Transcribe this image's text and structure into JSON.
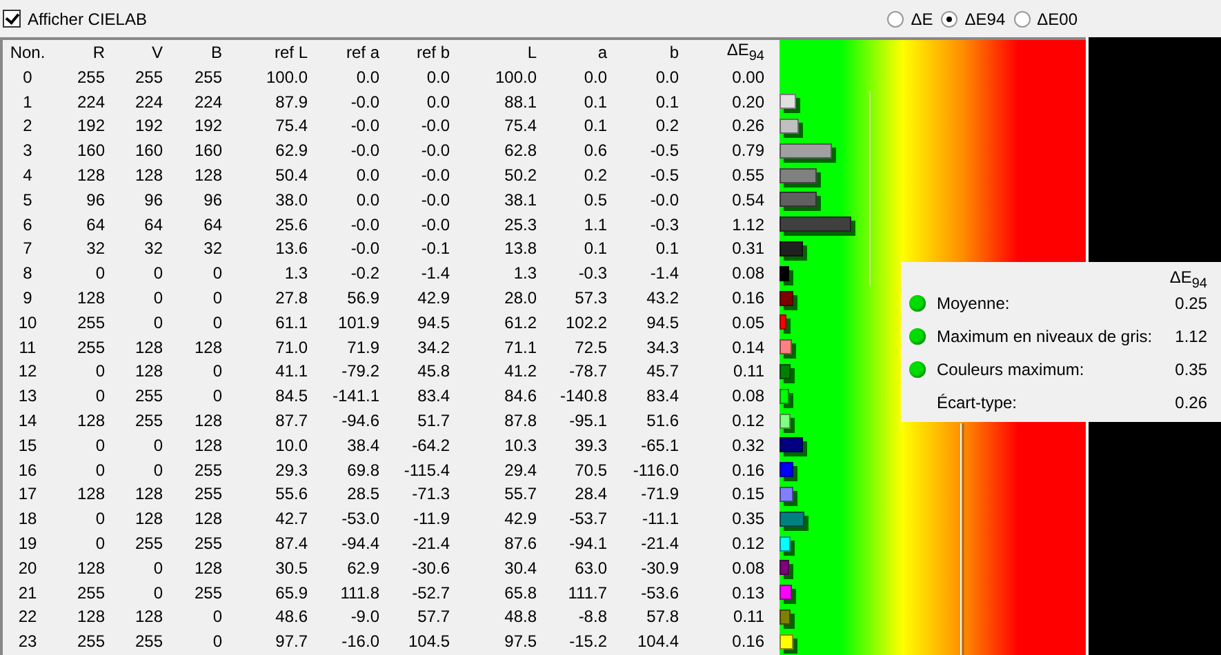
{
  "options": {
    "show_cielab": {
      "label": "Afficher CIELAB",
      "checked": true
    },
    "metrics": [
      {
        "label": "ΔE",
        "selected": false
      },
      {
        "label": "ΔE94",
        "selected": true
      },
      {
        "label": "ΔE00",
        "selected": false
      }
    ]
  },
  "table": {
    "columns": [
      "Non.",
      "R",
      "V",
      "B",
      "ref L",
      "ref a",
      "ref b",
      "L",
      "a",
      "b",
      "ΔE$_{94}$"
    ],
    "rows": [
      {
        "cells": [
          "0",
          "255",
          "255",
          "255",
          "100.0",
          "0.0",
          "0.0",
          "100.0",
          "0.0",
          "0.0",
          "0.00"
        ]
      },
      {
        "cells": [
          "1",
          "224",
          "224",
          "224",
          "87.9",
          "-0.0",
          "0.0",
          "88.1",
          "0.1",
          "0.1",
          "0.20"
        ]
      },
      {
        "cells": [
          "2",
          "192",
          "192",
          "192",
          "75.4",
          "-0.0",
          "-0.0",
          "75.4",
          "0.1",
          "0.2",
          "0.26"
        ]
      },
      {
        "cells": [
          "3",
          "160",
          "160",
          "160",
          "62.9",
          "-0.0",
          "-0.0",
          "62.8",
          "0.6",
          "-0.5",
          "0.79"
        ]
      },
      {
        "cells": [
          "4",
          "128",
          "128",
          "128",
          "50.4",
          "0.0",
          "-0.0",
          "50.2",
          "0.2",
          "-0.5",
          "0.55"
        ]
      },
      {
        "cells": [
          "5",
          "96",
          "96",
          "96",
          "38.0",
          "0.0",
          "-0.0",
          "38.1",
          "0.5",
          "-0.0",
          "0.54"
        ]
      },
      {
        "cells": [
          "6",
          "64",
          "64",
          "64",
          "25.6",
          "-0.0",
          "-0.0",
          "25.3",
          "1.1",
          "-0.3",
          "1.12"
        ]
      },
      {
        "cells": [
          "7",
          "32",
          "32",
          "32",
          "13.6",
          "-0.0",
          "-0.1",
          "13.8",
          "0.1",
          "0.1",
          "0.31"
        ]
      },
      {
        "cells": [
          "8",
          "0",
          "0",
          "0",
          "1.3",
          "-0.2",
          "-1.4",
          "1.3",
          "-0.3",
          "-1.4",
          "0.08"
        ]
      },
      {
        "cells": [
          "9",
          "128",
          "0",
          "0",
          "27.8",
          "56.9",
          "42.9",
          "28.0",
          "57.3",
          "43.2",
          "0.16"
        ]
      },
      {
        "cells": [
          "10",
          "255",
          "0",
          "0",
          "61.1",
          "101.9",
          "94.5",
          "61.2",
          "102.2",
          "94.5",
          "0.05"
        ]
      },
      {
        "cells": [
          "11",
          "255",
          "128",
          "128",
          "71.0",
          "71.9",
          "34.2",
          "71.1",
          "72.5",
          "34.3",
          "0.14"
        ]
      },
      {
        "cells": [
          "12",
          "0",
          "128",
          "0",
          "41.1",
          "-79.2",
          "45.8",
          "41.2",
          "-78.7",
          "45.7",
          "0.11"
        ]
      },
      {
        "cells": [
          "13",
          "0",
          "255",
          "0",
          "84.5",
          "-141.1",
          "83.4",
          "84.6",
          "-140.8",
          "83.4",
          "0.08"
        ]
      },
      {
        "cells": [
          "14",
          "128",
          "255",
          "128",
          "87.7",
          "-94.6",
          "51.7",
          "87.8",
          "-95.1",
          "51.6",
          "0.12"
        ]
      },
      {
        "cells": [
          "15",
          "0",
          "0",
          "128",
          "10.0",
          "38.4",
          "-64.2",
          "10.3",
          "39.3",
          "-65.1",
          "0.32"
        ]
      },
      {
        "cells": [
          "16",
          "0",
          "0",
          "255",
          "29.3",
          "69.8",
          "-115.4",
          "29.4",
          "70.5",
          "-116.0",
          "0.16"
        ]
      },
      {
        "cells": [
          "17",
          "128",
          "128",
          "255",
          "55.6",
          "28.5",
          "-71.3",
          "55.7",
          "28.4",
          "-71.9",
          "0.15"
        ]
      },
      {
        "cells": [
          "18",
          "0",
          "128",
          "128",
          "42.7",
          "-53.0",
          "-11.9",
          "42.9",
          "-53.7",
          "-11.1",
          "0.35"
        ]
      },
      {
        "cells": [
          "19",
          "0",
          "255",
          "255",
          "87.4",
          "-94.4",
          "-21.4",
          "87.6",
          "-94.1",
          "-21.4",
          "0.12"
        ]
      },
      {
        "cells": [
          "20",
          "128",
          "0",
          "128",
          "30.5",
          "62.9",
          "-30.6",
          "30.4",
          "63.0",
          "-30.9",
          "0.08"
        ]
      },
      {
        "cells": [
          "21",
          "255",
          "0",
          "255",
          "65.9",
          "111.8",
          "-52.7",
          "65.8",
          "111.7",
          "-53.6",
          "0.13"
        ]
      },
      {
        "cells": [
          "22",
          "128",
          "128",
          "0",
          "48.6",
          "-9.0",
          "57.7",
          "48.8",
          "-8.8",
          "57.8",
          "0.11"
        ]
      },
      {
        "cells": [
          "23",
          "255",
          "255",
          "0",
          "97.7",
          "-16.0",
          "104.5",
          "97.5",
          "-15.2",
          "104.4",
          "0.16"
        ]
      }
    ]
  },
  "summary": {
    "heading": "ΔE$_{94}$",
    "rows": [
      {
        "label": "Moyenne:",
        "value": "0.25",
        "indicator": true
      },
      {
        "label": "Maximum en niveaux de gris:",
        "value": "1.12",
        "indicator": true
      },
      {
        "label": "Couleurs maximum:",
        "value": "0.35",
        "indicator": true
      },
      {
        "label": "Écart-type:",
        "value": "0.26",
        "indicator": false
      }
    ]
  }
}
